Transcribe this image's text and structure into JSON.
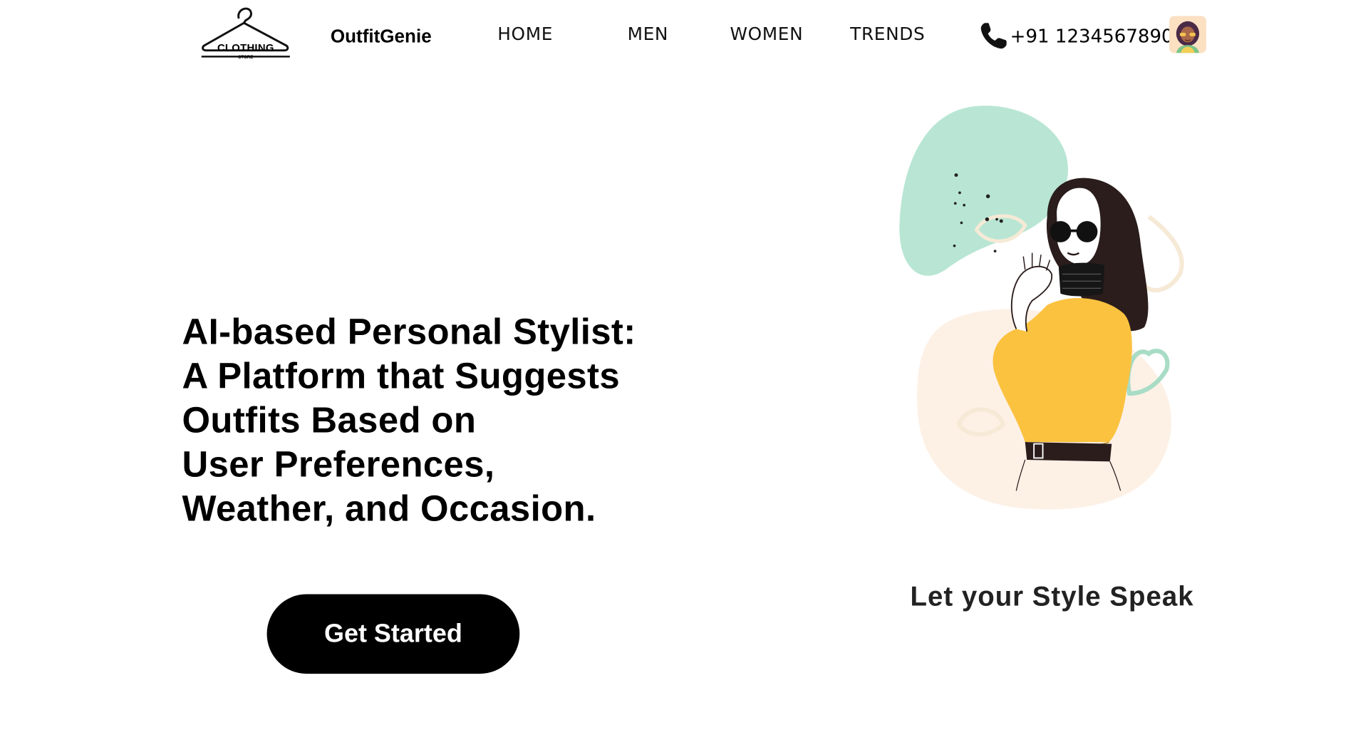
{
  "header": {
    "logo": {
      "text": "CLOTHING",
      "subtext": "STORE",
      "icon": "hanger-icon"
    },
    "brand": "OutfitGenie",
    "nav": [
      {
        "label": "HOME"
      },
      {
        "label": "MEN"
      },
      {
        "label": "WOMEN"
      },
      {
        "label": "TRENDS"
      }
    ],
    "phone": {
      "icon": "phone-icon",
      "number": "+91 1234567890"
    },
    "avatar": {
      "icon": "user-avatar"
    }
  },
  "hero": {
    "headline_lines": [
      "AI-based Personal Stylist:",
      "A Platform that Suggests",
      "Outfits Based on",
      "User Preferences,",
      "Weather, and Occasion."
    ],
    "cta_label": "Get Started",
    "illustration": "woman-in-sunglasses-illustration",
    "tagline": "Let your Style Speak"
  },
  "colors": {
    "background": "#ffffff",
    "text": "#000000",
    "button_bg": "#000000",
    "button_text": "#ffffff",
    "mint_blob": "#b9e6d4",
    "peach_blob": "#fdf1e6",
    "sweater": "#fbc23f"
  }
}
